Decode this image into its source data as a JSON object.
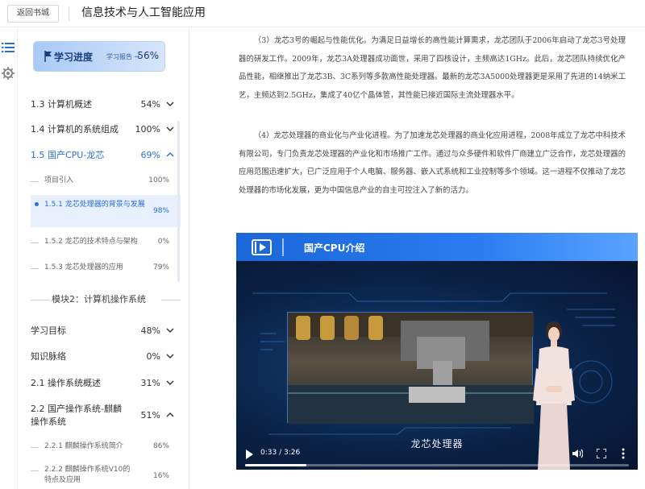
{
  "topbar": {
    "back_label": "返回书城",
    "book_title": "信息技术与人工智能应用"
  },
  "rail": {
    "icons": [
      "list-icon",
      "gear-icon"
    ]
  },
  "progress": {
    "title": "学习进度",
    "report_label": "学习报告 →",
    "percent": "56%"
  },
  "nav": {
    "item_1_3": {
      "label": "1.3 计算机概述",
      "pct": "54%"
    },
    "item_1_4": {
      "label": "1.4 计算机的系统组成",
      "pct": "100%"
    },
    "item_1_5": {
      "label": "1.5 国产CPU-龙芯",
      "pct": "69%"
    },
    "sub_intro": {
      "label": "项目引入",
      "pct": "100%"
    },
    "sub_1_5_1": {
      "label": "1.5.1 龙芯处理器的背景与发展",
      "pct": "98%"
    },
    "sub_1_5_2": {
      "label": "1.5.2 龙芯的技术特点与架构",
      "pct": "0%"
    },
    "sub_1_5_3": {
      "label": "1.5.3 龙芯处理器的应用",
      "pct": "79%"
    },
    "module_2": "模块2：计算机操作系统",
    "goals": {
      "label": "学习目标",
      "pct": "48%"
    },
    "knowledge": {
      "label": "知识脉络",
      "pct": "0%"
    },
    "item_2_1": {
      "label": "2.1 操作系统概述",
      "pct": "31%"
    },
    "item_2_2": {
      "label": "2.2 国产操作系统-麒麟操作系统",
      "pct": "51%"
    },
    "sub_2_2_1": {
      "label": "2.2.1 麒麟操作系统简介",
      "pct": "86%"
    },
    "sub_2_2_2": {
      "label": "2.2.2 麒麟操作系统V10的特点及应用",
      "pct": "16%"
    }
  },
  "content": {
    "para_3": "（3）龙芯3号的崛起与性能优化。为满足日益增长的高性能计算需求，龙芯团队于2006年启动了龙芯3号处理器的研发工作。2009年，龙芯3A处理器成功面世，采用了四核设计，主频高达1GHz。此后，龙芯团队持续优化产品性能，相继推出了龙芯3B、3C系列等多款高性能处理器。最新的龙芯3A5000处理器更是采用了先进的14纳米工艺，主频达到2.5GHz，集成了40亿个晶体管，其性能已接近国际主流处理器水平。",
    "para_4": "（4）龙芯处理器的商业化与产业化进程。为了加速龙芯处理器的商业化应用进程，2008年成立了龙芯中科技术有限公司，专门负责龙芯处理器的产业化和市场推广工作。通过与众多硬件和软件厂商建立广泛合作，龙芯处理器的应用范围迅速扩大，已广泛应用于个人电脑、服务器、嵌入式系统和工业控制等多个领域。这一进程不仅推动了龙芯处理器的市场化发展，更为中国信息产业的自主可控注入了新的活力。"
  },
  "video": {
    "header_title": "国产CPU介绍",
    "caption": "龙芯处理器",
    "time": "0:33 / 3:26",
    "played_fraction": 0.16
  },
  "colors": {
    "accent": "#2b6de0",
    "video_header": "#1b66d8"
  }
}
